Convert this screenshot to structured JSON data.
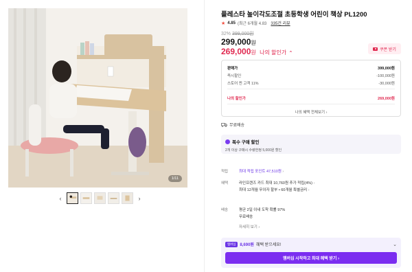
{
  "gallery": {
    "image_counter": "1/11",
    "prev_arrow": "‹",
    "next_arrow": "›",
    "thumbnail_count": 5
  },
  "product": {
    "title": "플레스타 높이각도조절 초등학생 어린이 책상 PL1200",
    "rating": {
      "score": "4.85",
      "recent": "(최근 6개월 4.83",
      "reviews": "335건 리뷰"
    },
    "discount_percent": "32%",
    "original_price": "399,000원",
    "price": "299,000",
    "price_unit": "원",
    "my_price": "269,000",
    "my_price_unit": "원",
    "my_price_label": "나의 할인가",
    "coupon_button": "쿠폰 받기"
  },
  "breakdown": {
    "rows": [
      {
        "label": "판매가",
        "value": "399,000원"
      },
      {
        "label": "즉시할인",
        "value": "-100,000원"
      },
      {
        "label": "스토어 찐 고객 11%",
        "value": "-30,000원"
      }
    ],
    "final_label": "나의 할인가",
    "final_value": "269,000원",
    "view_all": "나의 혜택 전체보기 ›"
  },
  "shipping": {
    "text": "무료배송"
  },
  "bundle": {
    "title": "복수 구매 할인",
    "desc": "2개 이상 구매시 수량한정 5,000원 할인"
  },
  "details": {
    "points_label": "적립",
    "points_value": "최대 적립 포인트 47,510원",
    "benefit_label": "혜택",
    "benefit_line1": "라인프렌즈 카드 최대 10,760원 추가 적립(4%)",
    "benefit_line2": "최대 12개월 무이자 할부 • 60개월 특별금리",
    "delivery_label": "배송",
    "delivery_line1": "평균 2일 이내 도착 확률 97%",
    "delivery_line2": "무료배송",
    "delivery_more": "자세히 보기 ›"
  },
  "membership": {
    "badge": "멤버십",
    "amount": "8,690원",
    "text": "혜택 받으세요!",
    "button": "멤버십 시작하고 최대 혜택 받기 ›"
  },
  "colors": {
    "accent_red": "#e0284f",
    "accent_purple": "#7b2df0"
  }
}
